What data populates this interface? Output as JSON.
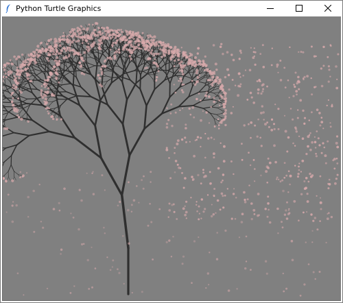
{
  "window": {
    "title": "Python Turtle Graphics",
    "controls": {
      "minimize": "minimize",
      "maximize": "maximize",
      "close": "close"
    }
  },
  "canvas": {
    "background": "#808080",
    "branch_color": "#2f2f2f",
    "petal_color": "#d7a9ab",
    "drawing": "fractal cherry-blossom tree"
  },
  "icons": {
    "app": "feather-icon",
    "minimize": "minimize-icon",
    "maximize": "maximize-icon",
    "close": "close-icon"
  }
}
